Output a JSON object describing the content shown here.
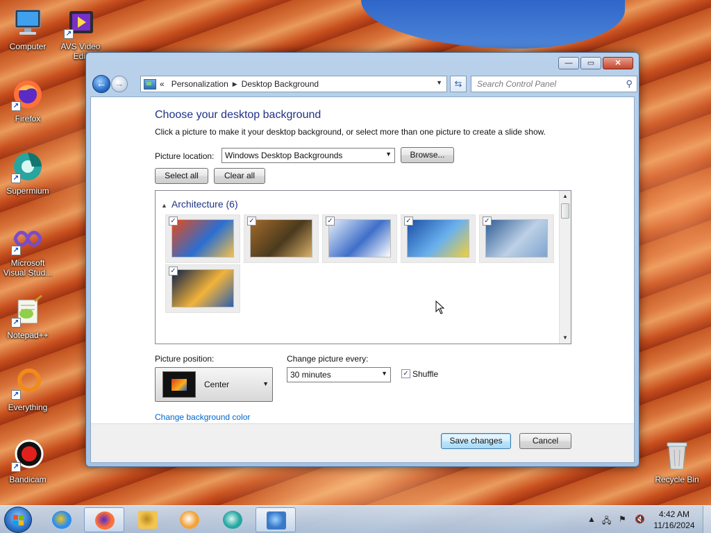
{
  "desktop": {
    "icons": [
      {
        "label": "Computer",
        "icon": "computer-icon"
      },
      {
        "label": "AVS Video Edit",
        "icon": "avs-video-editor-icon"
      },
      {
        "label": "Firefox",
        "icon": "firefox-icon"
      },
      {
        "label": "Supermium",
        "icon": "supermium-icon"
      },
      {
        "label": "Microsoft Visual Stud...",
        "icon": "visual-studio-icon"
      },
      {
        "label": "Notepad++",
        "icon": "notepad-plus-plus-icon"
      },
      {
        "label": "Everything",
        "icon": "everything-search-icon"
      },
      {
        "label": "Bandicam",
        "icon": "bandicam-icon"
      },
      {
        "label": "Recycle Bin",
        "icon": "recycle-bin-icon"
      }
    ]
  },
  "window": {
    "controls": {
      "minimize": "—",
      "maximize": "▭",
      "close": "✕"
    },
    "address": {
      "prefix": "«",
      "crumbs": [
        "Personalization",
        "Desktop Background"
      ],
      "separator": "▶"
    },
    "search": {
      "placeholder": "Search Control Panel"
    },
    "heading": "Choose your desktop background",
    "description": "Click a picture to make it your desktop background, or select more than one picture to create a slide show.",
    "picture_location": {
      "label": "Picture location:",
      "value": "Windows Desktop Backgrounds",
      "browse": "Browse..."
    },
    "select_all": "Select all",
    "clear_all": "Clear all",
    "gallery": {
      "group": "Architecture (6)",
      "items": [
        {
          "name": "architecture-1",
          "checked": true,
          "colors": [
            "#e8491d",
            "#2a6fd1",
            "#f4c04a"
          ]
        },
        {
          "name": "architecture-2",
          "checked": true,
          "colors": [
            "#a26a2a",
            "#4b3a1e",
            "#d9b06a"
          ]
        },
        {
          "name": "architecture-3",
          "checked": true,
          "colors": [
            "#e6eef8",
            "#3f6fc9",
            "#ffffff"
          ]
        },
        {
          "name": "architecture-4",
          "checked": true,
          "colors": [
            "#1a4fa6",
            "#6ab0ee",
            "#f2cf39"
          ]
        },
        {
          "name": "architecture-5",
          "checked": true,
          "colors": [
            "#2f5d95",
            "#bcd0e6",
            "#7fa4cf"
          ]
        },
        {
          "name": "architecture-6",
          "checked": true,
          "colors": [
            "#0b1f4a",
            "#f2b33a",
            "#2b5fb0"
          ]
        }
      ]
    },
    "picture_position": {
      "label": "Picture position:",
      "value": "Center"
    },
    "change_every": {
      "label": "Change picture every:",
      "value": "30 minutes"
    },
    "shuffle": {
      "label": "Shuffle",
      "checked": true
    },
    "bg_color_link": "Change background color",
    "save": "Save changes",
    "cancel": "Cancel"
  },
  "taskbar": {
    "items": [
      "internet-explorer-icon",
      "firefox-icon",
      "file-explorer-icon",
      "media-player-icon",
      "supermium-icon",
      "control-panel-icon"
    ],
    "time": "4:42 AM",
    "date": "11/16/2024"
  },
  "colors": {
    "heading": "#1e3287",
    "link": "#0066cc",
    "accent": "#3c7fb1"
  }
}
